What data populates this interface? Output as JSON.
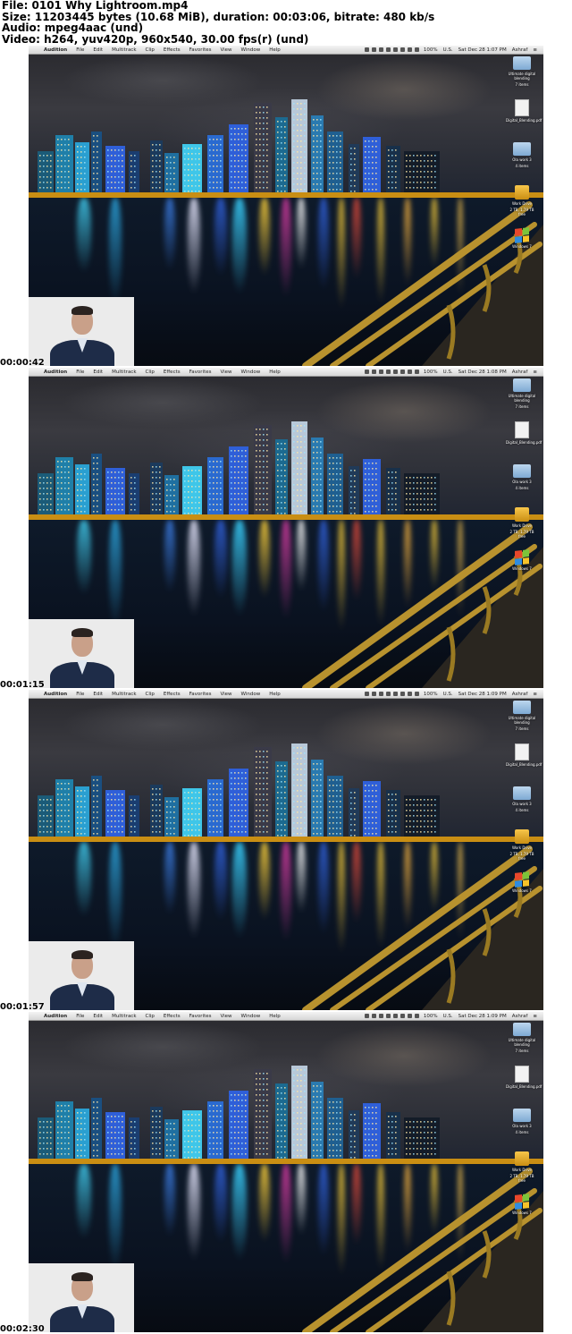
{
  "info": {
    "file_line": "File: 0101 Why Lightroom.mp4",
    "size_line": "Size: 11203445 bytes (10.68 MiB), duration: 00:03:06, bitrate: 480 kb/s",
    "audio_line": "Audio: mpeg4aac (und)",
    "video_line": "Video: h264, yuv420p, 960x540, 30.00 fps(r) (und)"
  },
  "menubar": {
    "apple_glyph": "",
    "items": [
      "Audition",
      "File",
      "Edit",
      "Multitrack",
      "Clip",
      "Effects",
      "Favorites",
      "View",
      "Window",
      "Help"
    ],
    "battery": "100%",
    "flag": "U.S.",
    "user": "Ashraf",
    "list_glyph": "≡"
  },
  "desktop_items": [
    {
      "label": "Ultimate digital blending",
      "sub": "7 items",
      "icon": "folder-icon"
    },
    {
      "label": "Digital_Blending.pdf",
      "sub": "",
      "icon": "pdf-icon"
    },
    {
      "label": "Ola work 3",
      "sub": "4 items",
      "icon": "folder-icon"
    },
    {
      "label": "Work Drive",
      "sub": "2 TB, 1.79 TB free",
      "icon": "drive-icon"
    },
    {
      "label": "Windows 7",
      "sub": "",
      "icon": "windows-icon"
    }
  ],
  "frames": [
    {
      "clock": "Sat Dec 28  1:07 PM",
      "timestamp": "00:00:42"
    },
    {
      "clock": "Sat Dec 28  1:08 PM",
      "timestamp": "00:01:15"
    },
    {
      "clock": "Sat Dec 28  1:09 PM",
      "timestamp": "00:01:57"
    },
    {
      "clock": "Sat Dec 28  1:09 PM",
      "timestamp": "00:02:30"
    }
  ],
  "colors": {
    "menubar": "#e4e4e4",
    "building_cyan": "#3fc6e8",
    "building_blue": "#2f5fd8",
    "light_yellow": "#ffd23a",
    "light_magenta": "#d43aa0",
    "railing_gold": "#b8922e"
  }
}
